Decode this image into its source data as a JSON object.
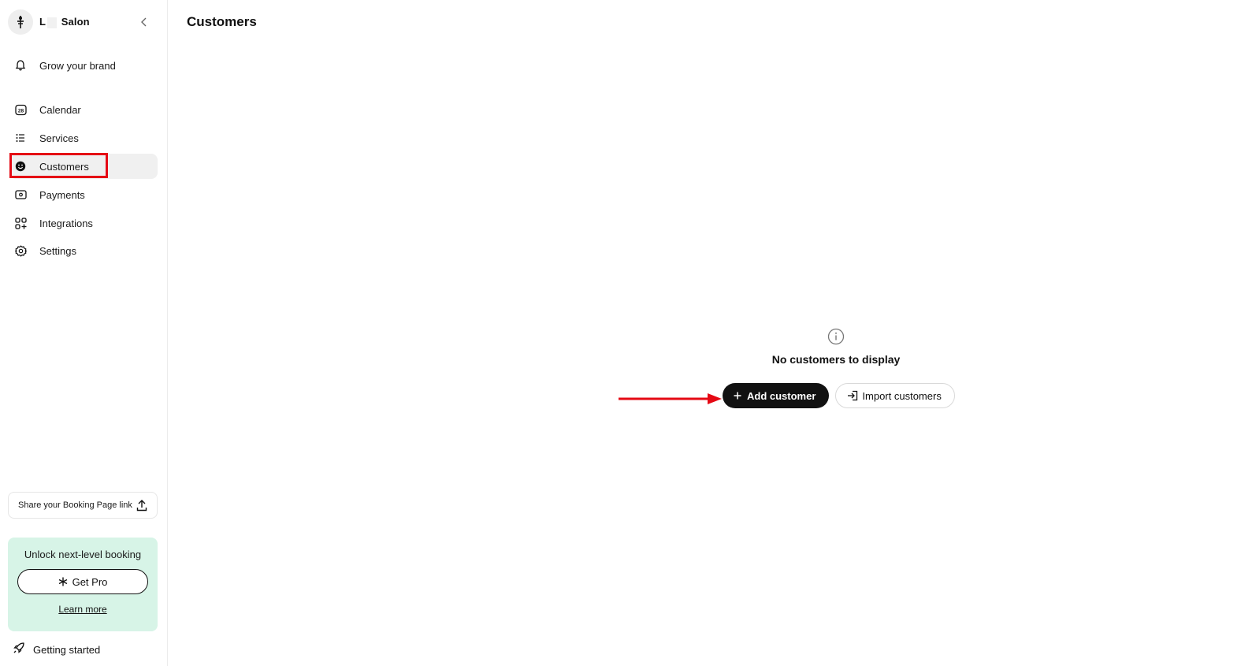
{
  "sidebar": {
    "brand": {
      "initial": "L",
      "name": "Salon"
    },
    "promo_link": {
      "label": "Grow your brand"
    },
    "items": [
      {
        "label": "Calendar",
        "icon": "calendar-icon"
      },
      {
        "label": "Services",
        "icon": "list-icon"
      },
      {
        "label": "Customers",
        "icon": "smiley-icon"
      },
      {
        "label": "Payments",
        "icon": "payment-icon"
      },
      {
        "label": "Integrations",
        "icon": "grid-plus-icon"
      },
      {
        "label": "Settings",
        "icon": "gear-icon"
      }
    ],
    "calendar_day": "28",
    "share": {
      "label": "Share your Booking Page link"
    },
    "upgrade": {
      "title": "Unlock next-level booking",
      "button_label": "Get Pro",
      "link_label": "Learn more"
    },
    "getting_started": {
      "label": "Getting started"
    }
  },
  "main": {
    "title": "Customers",
    "empty_state": {
      "message": "No customers to display",
      "primary_action": "Add customer",
      "secondary_action": "Import customers"
    }
  },
  "colors": {
    "accent": "#111111",
    "active_bg": "#f0f0f0",
    "promo_bg": "#d7f4e7",
    "annotation_red": "#e50914"
  }
}
